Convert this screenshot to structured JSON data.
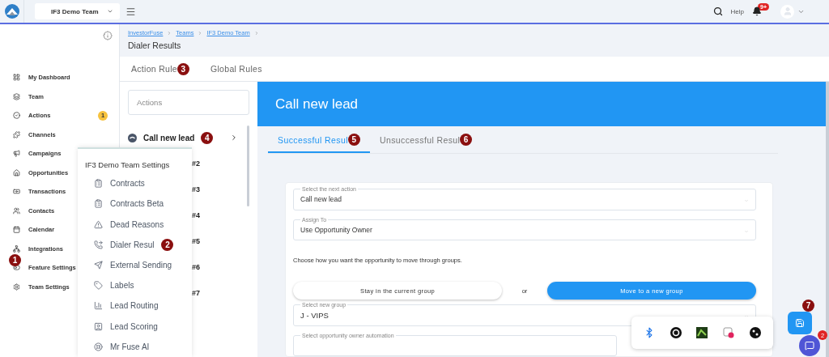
{
  "top_bar": {
    "team_select": "IF3 Demo Team",
    "help": "Help",
    "notification_count": "9+"
  },
  "sidebar": {
    "items": [
      {
        "label": "My Dashboard"
      },
      {
        "label": "Team"
      },
      {
        "label": "Actions",
        "badge": "1"
      },
      {
        "label": "Channels"
      },
      {
        "label": "Campaigns"
      },
      {
        "label": "Opportunities"
      },
      {
        "label": "Transactions"
      },
      {
        "label": "Contacts"
      },
      {
        "label": "Calendar"
      },
      {
        "label": "Integrations"
      },
      {
        "label": "Feature Settings",
        "callout": "1"
      },
      {
        "label": "Team Settings"
      }
    ]
  },
  "breadcrumb": {
    "links": [
      "InvestorFuse",
      "Teams",
      "IF3 Demo Team"
    ],
    "title": "Dialer Results"
  },
  "rule_tabs": [
    {
      "label": "Action Rule",
      "callout": "3"
    },
    {
      "label": "Global Rules"
    }
  ],
  "actions_panel": {
    "search_placeholder": "Actions",
    "items": [
      {
        "label": "Call new lead",
        "callout": "4"
      },
      {
        "label": "#2"
      },
      {
        "label": "#3"
      },
      {
        "label": "#4"
      },
      {
        "label": "#5"
      },
      {
        "label": "#6"
      },
      {
        "label": "#7"
      }
    ]
  },
  "settings_menu": {
    "title": "IF3 Demo Team Settings",
    "items": [
      {
        "label": "Contracts"
      },
      {
        "label": "Contracts Beta"
      },
      {
        "label": "Dead Reasons"
      },
      {
        "label": "Dialer Resul",
        "callout": "2"
      },
      {
        "label": "External Sending"
      },
      {
        "label": "Labels"
      },
      {
        "label": "Lead Routing"
      },
      {
        "label": "Lead Scoring"
      },
      {
        "label": "Mr Fuse AI"
      }
    ]
  },
  "detail": {
    "title": "Call new lead",
    "tabs": [
      {
        "label": "Successful Resul",
        "selected": true,
        "callout": "5"
      },
      {
        "label": "Unsuccessful Resul",
        "selected": false,
        "callout": "6"
      }
    ],
    "fields_top": [
      {
        "label": "Select the next action",
        "value": "Call new lead"
      },
      {
        "label": "Assign To",
        "value": "Use Opportunity Owner"
      }
    ],
    "group_note": "Choose how you want the opportunity to move through groups.",
    "group_choice": [
      {
        "label": "Stay in the current group",
        "selected": false
      },
      {
        "label": "Move to a new group",
        "selected": true
      }
    ],
    "or": "or",
    "fields_bottom": [
      {
        "label": "Select new group",
        "value": "J - VIPS"
      },
      {
        "label": "Select opportunity owner automation"
      }
    ]
  },
  "save_button": {
    "callout": "7"
  },
  "chat_button": {
    "badge": "2"
  }
}
